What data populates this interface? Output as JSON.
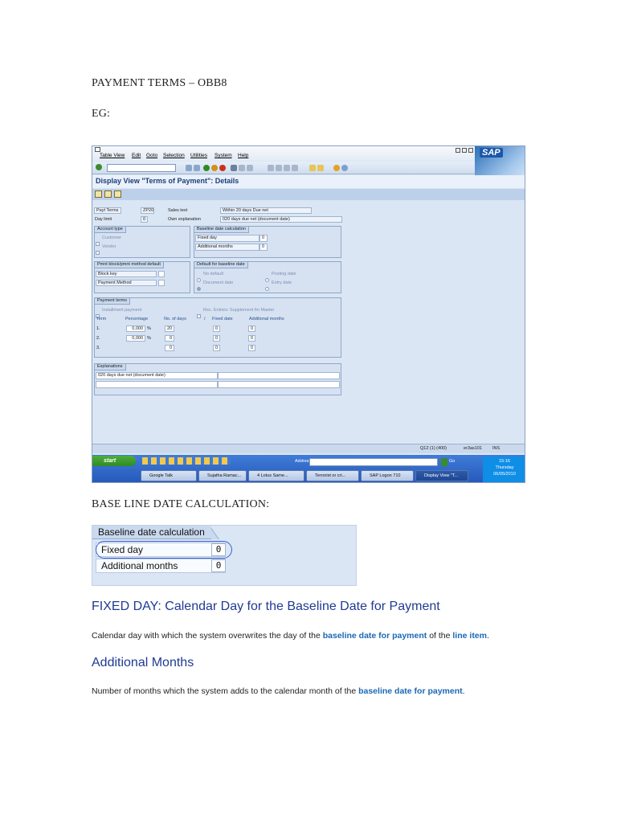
{
  "doc": {
    "heading_1": "PAYMENT TERMS – OBB8",
    "heading_2": "EG:",
    "heading_3": "BASE LINE DATE CALCULATION:",
    "section_fixed_day": "FIXED DAY: Calendar Day for the Baseline Date for Payment",
    "fixed_day_text_1": "Calendar day with which the system overwrites the day of the ",
    "fixed_day_link_1": "baseline date for payment",
    "fixed_day_text_2": " of the ",
    "fixed_day_link_2": "line item",
    "fixed_day_text_3": ".",
    "section_additional": "Additional Months",
    "additional_text_1": "Number of months which the system adds to the calendar month of the ",
    "additional_link": "baseline date for payment",
    "additional_text_2": "."
  },
  "sap": {
    "menu": [
      "Table View",
      "Edit",
      "Goto",
      "Selection",
      "Utilities",
      "System",
      "Help"
    ],
    "logo": "SAP",
    "screen_title": "Display View \"Terms of Payment\": Details",
    "pay_terms_label": "Payt Terms",
    "pay_terms_value": "ZP20",
    "sales_text_label": "Sales text",
    "sales_text_value": "Within 20 days Due net",
    "day_limit_label": "Day limit",
    "day_limit_value": "0",
    "own_expl_label": "Own explanation",
    "own_expl_value": "020 days due net (document date)",
    "account_type": {
      "title": "Account type",
      "customer": "Customer",
      "vendor": "Vendor"
    },
    "baseline_calc": {
      "title": "Baseline date calculation",
      "fixed_day_label": "Fixed day",
      "fixed_day_value": "0",
      "additional_months_label": "Additional months",
      "additional_months_value": "0"
    },
    "pmnt_block": {
      "title": "Pmnt block/pmnt method default",
      "block_key": "Block key",
      "payment_method": "Payment Method"
    },
    "default_baseline": {
      "title": "Default for baseline date",
      "no_default": "No default",
      "posting_date": "Posting date",
      "document_date": "Document date",
      "entry_date": "Entry date"
    },
    "payment_terms": {
      "title": "Payment terms",
      "installment": "Installment payment",
      "rec_entries": "Rec. Entries: Supplement fm Master",
      "headers": [
        "Term",
        "Percentage",
        "No. of days",
        "/",
        "Fixed date",
        "Additional months"
      ],
      "rows": [
        {
          "term": "1.",
          "pct": "0,000",
          "unit": "%",
          "days": "20",
          "fixed": "0",
          "add": "0"
        },
        {
          "term": "2.",
          "pct": "0,000",
          "unit": "%",
          "days": "0",
          "fixed": "0",
          "add": "0"
        },
        {
          "term": "3.",
          "pct": "",
          "unit": "",
          "days": "0",
          "fixed": "0",
          "add": "0"
        }
      ]
    },
    "explanations": {
      "title": "Explanations",
      "line_1": "020 days due net (document date)"
    },
    "status": {
      "system": "Q12 (1) (400)",
      "server": "er3as101",
      "mode": "INS"
    },
    "taskbar": {
      "start": "start",
      "address_label": "Address",
      "go": "Go",
      "tasks": [
        "Google Talk",
        "Sujatha Ramac...",
        "4 Lotus Same...",
        "Terrorist or cri...",
        "SAP Logon 710",
        "Display View \"T..."
      ],
      "time": "15:16",
      "day": "Thursday",
      "date": "06/05/2010"
    }
  },
  "zoom": {
    "title": "Baseline date calculation",
    "fixed_day_label": "Fixed day",
    "fixed_day_value": "0",
    "additional_months_label": "Additional months",
    "additional_months_value": "0"
  }
}
